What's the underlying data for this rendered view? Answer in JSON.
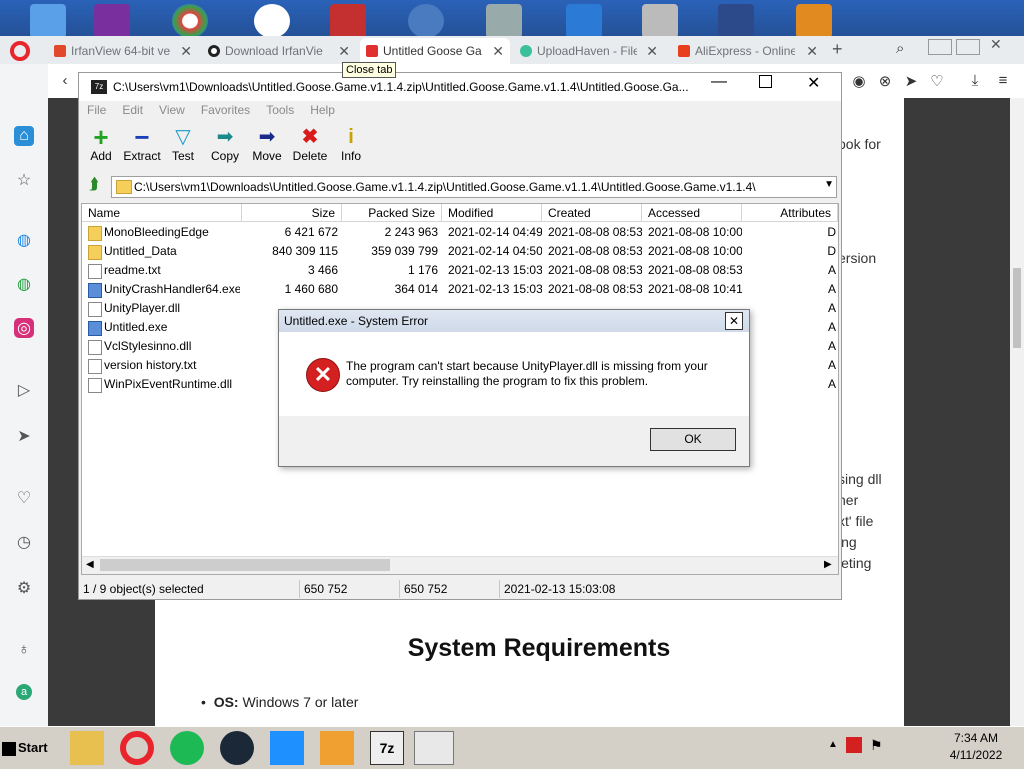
{
  "browser": {
    "tabs": [
      {
        "title": "IrfanView 64-bit ve",
        "favicon_color": "#e04a2a"
      },
      {
        "title": "Download IrfanVie",
        "favicon_color": "#222222"
      },
      {
        "title": "Untitled Goose Ga",
        "favicon_color": "#e03030",
        "active": true
      },
      {
        "title": "UploadHaven - File",
        "favicon_color": "#3cbf9b"
      },
      {
        "title": "AliExpress - Online",
        "favicon_color": "#e8401c"
      }
    ],
    "tooltip": "Close tab",
    "page": {
      "heading": "System Requirements",
      "req_label": "OS:",
      "req_value": "Windows 7 or later",
      "side_text": [
        "ook for",
        "ersion",
        "sing dll",
        "her",
        "xt' file",
        "ing",
        "leting"
      ]
    }
  },
  "zip": {
    "title": "C:\\Users\\vm1\\Downloads\\Untitled.Goose.Game.v1.1.4.zip\\Untitled.Goose.Game.v1.1.4\\Untitled.Goose.Ga...",
    "menu": [
      "File",
      "Edit",
      "View",
      "Favorites",
      "Tools",
      "Help"
    ],
    "toolbar": [
      {
        "label": "Add",
        "icon": "plus-icon"
      },
      {
        "label": "Extract",
        "icon": "minus-icon"
      },
      {
        "label": "Test",
        "icon": "check-icon"
      },
      {
        "label": "Copy",
        "icon": "copy-arrow-icon"
      },
      {
        "label": "Move",
        "icon": "move-arrow-icon"
      },
      {
        "label": "Delete",
        "icon": "delete-x-icon"
      },
      {
        "label": "Info",
        "icon": "info-icon"
      }
    ],
    "path": "C:\\Users\\vm1\\Downloads\\Untitled.Goose.Game.v1.1.4.zip\\Untitled.Goose.Game.v1.1.4\\Untitled.Goose.Game.v1.1.4\\",
    "columns": [
      "Name",
      "Size",
      "Packed Size",
      "Modified",
      "Created",
      "Accessed",
      "Attributes"
    ],
    "files": [
      {
        "name": "MonoBleedingEdge",
        "type": "folder",
        "size": "6 421 672",
        "packed": "2 243 963",
        "modified": "2021-02-14 04:49",
        "created": "2021-08-08 08:53",
        "accessed": "2021-08-08 10:00",
        "attr": "D"
      },
      {
        "name": "Untitled_Data",
        "type": "folder",
        "size": "840 309 115",
        "packed": "359 039 799",
        "modified": "2021-02-14 04:50",
        "created": "2021-08-08 08:53",
        "accessed": "2021-08-08 10:00",
        "attr": "D"
      },
      {
        "name": "readme.txt",
        "type": "txt",
        "size": "3 466",
        "packed": "1 176",
        "modified": "2021-02-13 15:03",
        "created": "2021-08-08 08:53",
        "accessed": "2021-08-08 08:53",
        "attr": "A"
      },
      {
        "name": "UnityCrashHandler64.exe",
        "type": "exe",
        "size": "1 460 680",
        "packed": "364 014",
        "modified": "2021-02-13 15:03",
        "created": "2021-08-08 08:53",
        "accessed": "2021-08-08 10:41",
        "attr": "A"
      },
      {
        "name": "UnityPlayer.dll",
        "type": "dll",
        "size": "",
        "packed": "",
        "modified": "",
        "created": "",
        "accessed": "",
        "attr": "A"
      },
      {
        "name": "Untitled.exe",
        "type": "exe",
        "size": "",
        "packed": "",
        "modified": "",
        "created": "",
        "accessed": "",
        "attr": "A"
      },
      {
        "name": "VclStylesinno.dll",
        "type": "dll",
        "size": "",
        "packed": "",
        "modified": "",
        "created": "",
        "accessed": "",
        "attr": "A"
      },
      {
        "name": "version history.txt",
        "type": "txt",
        "size": "",
        "packed": "",
        "modified": "",
        "created": "",
        "accessed": "",
        "attr": "A"
      },
      {
        "name": "WinPixEventRuntime.dll",
        "type": "dll",
        "size": "",
        "packed": "",
        "modified": "",
        "created": "",
        "accessed": "",
        "attr": "A"
      }
    ],
    "status": {
      "selection": "1 / 9 object(s) selected",
      "size": "650 752",
      "packed": "650 752",
      "date": "2021-02-13 15:03:08"
    }
  },
  "dialog": {
    "title": "Untitled.exe - System Error",
    "message": "The program can't start because UnityPlayer.dll is missing from your computer. Try reinstalling the program to fix this problem.",
    "ok_label": "OK"
  },
  "taskbar": {
    "start_label": "Start",
    "time": "7:34 AM",
    "date": "4/11/2022"
  }
}
